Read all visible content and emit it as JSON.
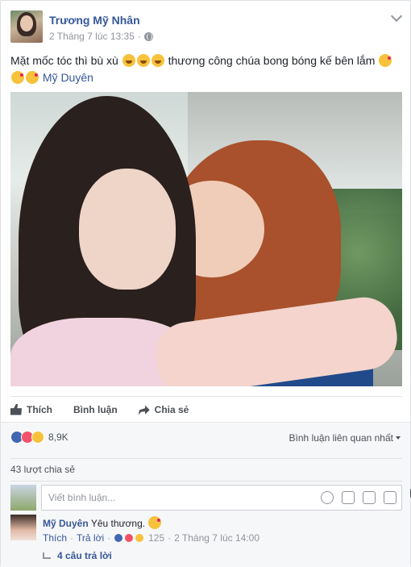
{
  "post": {
    "author": "Trương Mỹ Nhân",
    "timestamp": "2 Tháng 7 lúc 13:35",
    "separator": "·",
    "privacy_icon": "globe-icon",
    "text_part1": "Mặt mốc tóc thì bù xù",
    "text_part2": "thương công chúa bong bóng kế bên lắm",
    "mention": "Mỹ Duyên"
  },
  "actions": {
    "like": "Thích",
    "comment": "Bình luận",
    "share": "Chia sẻ"
  },
  "feedback": {
    "reaction_count": "8,9K",
    "sort_label": "Bình luận liên quan nhất",
    "shares": "43 lượt chia sẻ",
    "composer_placeholder": "Viết bình luận..."
  },
  "comment": {
    "author": "Mỹ Duyên",
    "text": "Yêu thương.",
    "like": "Thích",
    "reply": "Trả lời",
    "sep": "·",
    "reaction_count": "125",
    "time": "2 Tháng 7 lúc 14:00",
    "replies": "4 câu trả lời"
  },
  "colors": {
    "link": "#365899",
    "like_blue": "#4267b2",
    "love_red": "#f25268",
    "haha_yellow": "#f7c23b"
  }
}
